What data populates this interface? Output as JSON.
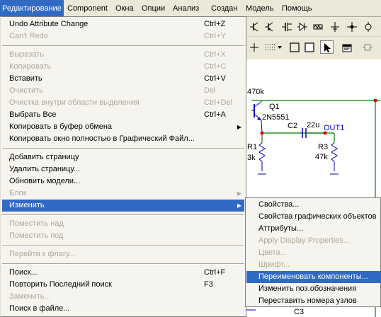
{
  "menubar": {
    "items": [
      "Редактирование",
      "Component",
      "Окна",
      "Опции",
      "Анализ",
      "Создан",
      "Модель",
      "Помощь"
    ]
  },
  "edit_menu": {
    "items": [
      {
        "label": "Undo Attribute Change",
        "shortcut": "Ctrl+Z",
        "disabled": false
      },
      {
        "label": "Can't Redo",
        "shortcut": "Ctrl+Y",
        "disabled": true
      },
      {
        "label": "Вырезать",
        "shortcut": "Ctrl+X",
        "disabled": true
      },
      {
        "label": "Копировать",
        "shortcut": "Ctrl+C",
        "disabled": true
      },
      {
        "label": "Вставить",
        "shortcut": "Ctrl+V",
        "disabled": false
      },
      {
        "label": "Очистить",
        "shortcut": "Del",
        "disabled": true
      },
      {
        "label": "Очистка внутри области выделения",
        "shortcut": "Ctrl+Del",
        "disabled": true
      },
      {
        "label": "Выбрать Все",
        "shortcut": "Ctrl+A",
        "disabled": false
      },
      {
        "label": "Копировать в буфер обмена",
        "shortcut": "",
        "disabled": false
      },
      {
        "label": "Копировать окно полностью в Графический Файл...",
        "shortcut": "",
        "disabled": false
      },
      {
        "label": "Добавить страницу",
        "shortcut": "",
        "disabled": false
      },
      {
        "label": "Удалить страницу...",
        "shortcut": "",
        "disabled": false
      },
      {
        "label": "Обновить модели...",
        "shortcut": "",
        "disabled": false
      },
      {
        "label": "Блок",
        "shortcut": "",
        "disabled": true
      },
      {
        "label": "Изменить",
        "shortcut": "",
        "disabled": false
      },
      {
        "label": "Поместить над",
        "shortcut": "",
        "disabled": true
      },
      {
        "label": "Поместить под",
        "shortcut": "",
        "disabled": true
      },
      {
        "label": "Перейти к флагу...",
        "shortcut": "",
        "disabled": true
      },
      {
        "label": "Поиск...",
        "shortcut": "Ctrl+F",
        "disabled": false
      },
      {
        "label": "Повторить Последний поиск",
        "shortcut": "F3",
        "disabled": false
      },
      {
        "label": "Заменить...",
        "shortcut": "",
        "disabled": true
      },
      {
        "label": "Поиск в файле...",
        "shortcut": "",
        "disabled": false
      }
    ]
  },
  "submenu": {
    "items": [
      {
        "label": "Свойства...",
        "disabled": false
      },
      {
        "label": "Свойства графических объектов",
        "disabled": false
      },
      {
        "label": "Аттрибуты...",
        "disabled": false
      },
      {
        "label": "Apply Display Properties...",
        "disabled": true
      },
      {
        "label": "Цвета...",
        "disabled": true
      },
      {
        "label": "Шрифт...",
        "disabled": true
      },
      {
        "label": "Переименовать компоненты...",
        "disabled": false
      },
      {
        "label": "Изменить поз.обозначения",
        "disabled": false
      },
      {
        "label": "Переставить номера узлов",
        "disabled": false
      }
    ]
  },
  "schematic": {
    "labels": [
      "470k",
      "Q1",
      "2N5551",
      "C2",
      "22u",
      "OUT1",
      "R1",
      "3k",
      "R3",
      "47k",
      "C3"
    ],
    "colors": {
      "wire": "#008000",
      "component": "#0000c0",
      "node": "#e00000"
    }
  },
  "toolbar_icons": [
    "npn-transistor-icon",
    "pnp-transistor-icon",
    "jfet-icon",
    "diode-icon",
    "resistor-icon",
    "ground-icon",
    "node-icon",
    "probe-icon",
    "plus-icon",
    "grid-dots-icon",
    "dropdown-arrow-icon",
    "rectangle-icon",
    "rectangle-icon",
    "select-arrow-icon",
    "properties-icon",
    "component-icon"
  ],
  "colors": {
    "highlight": "#316ac5",
    "menu_bg": "#f5f4ef",
    "chrome": "#ece9d8",
    "disabled_text": "#aca899"
  }
}
